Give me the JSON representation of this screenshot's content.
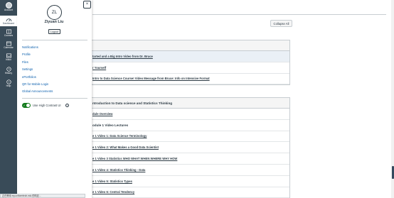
{
  "global_nav": {
    "items": [
      {
        "label": "Account",
        "icon": "user-circle-icon"
      },
      {
        "label": "Dashboard",
        "icon": "dashboard-icon"
      },
      {
        "label": "Courses",
        "icon": "book-icon"
      },
      {
        "label": "Calendar",
        "icon": "calendar-icon"
      },
      {
        "label": "Inbox",
        "icon": "inbox-icon"
      },
      {
        "label": "History",
        "icon": "clock-icon"
      },
      {
        "label": "Help",
        "icon": "help-icon"
      }
    ]
  },
  "tray": {
    "initials": "ZL",
    "user_name": "Ziyuan Liu",
    "logout_label": "Logout",
    "links": [
      "Notifications",
      "Profile",
      "Files",
      "Settings",
      "ePortfolios",
      "QR for Mobile Login",
      "Global Announcements"
    ],
    "high_contrast_label": "Use High Contrast UI",
    "close_glyph": "×"
  },
  "page": {
    "collapse_all_label": "Collapse All",
    "module1": {
      "items": [
        "tarted and a Big Intro Video from Dr. Bruce",
        "r Yourself",
        "Intro to Data Science Course! Video Message from Bruce: Info on Intensive Format"
      ]
    },
    "module2": {
      "title": "ntroduction to Data science and Statistics Thinking",
      "items": [
        "dule Overview",
        "odule 1 Video Lectures",
        "e 1 Video 1: Data Science Terminology",
        "e 1 Video 2: What Makes a Good Data Scientist",
        "e 1 Video 3 Statistics WHO WHAT WHEN WHERE WHY HOW",
        "e 1 Video 4: Statistics Thinking - Data",
        "e 1 Video 5: Statistics Types",
        "e 1 Video 6: Central Tendency"
      ]
    }
  },
  "status_bar": "正在等待 my.uniformtech.edu 的响应..."
}
